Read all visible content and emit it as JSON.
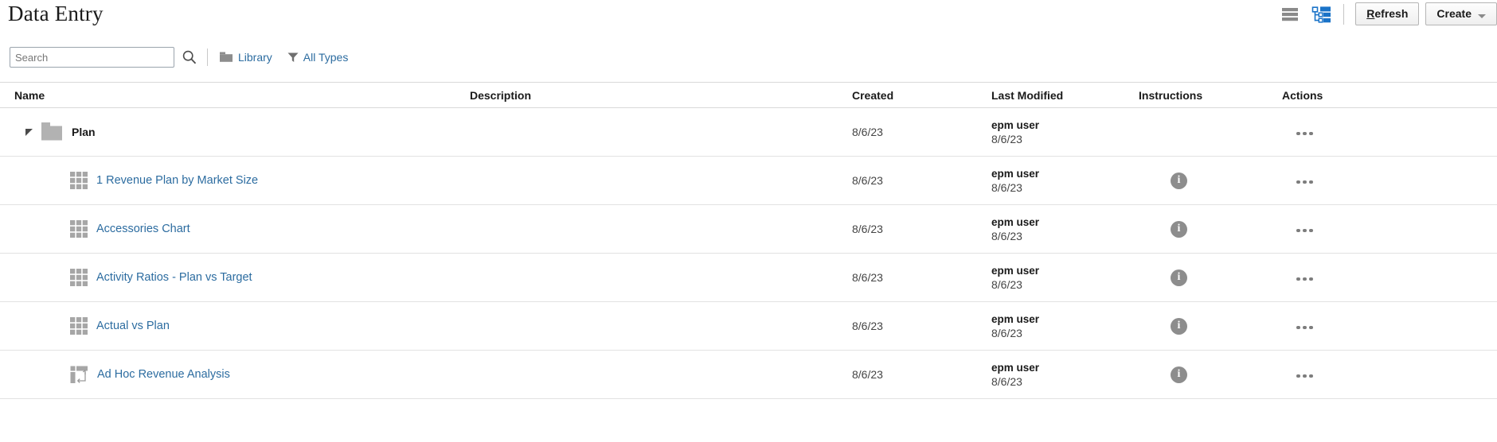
{
  "header": {
    "title": "Data Entry",
    "view_list_icon": "list-view-icon",
    "view_tree_icon": "tree-view-icon",
    "refresh_label_prefix": "R",
    "refresh_label_rest": "efresh",
    "create_label": "Create"
  },
  "toolbar": {
    "search_placeholder": "Search",
    "search_value": "",
    "search_icon": "search-icon",
    "library_label": "Library",
    "library_icon": "folder-icon",
    "all_types_label": "All Types",
    "all_types_icon": "filter-funnel-icon"
  },
  "table": {
    "columns": {
      "name": "Name",
      "description": "Description",
      "created": "Created",
      "last_modified": "Last Modified",
      "instructions": "Instructions",
      "actions": "Actions"
    },
    "rows": [
      {
        "type": "folder",
        "icon": "folder-icon",
        "name": "Plan",
        "description": "",
        "created": "8/6/23",
        "modified_user": "epm user",
        "modified_date": "8/6/23",
        "has_instructions": false
      },
      {
        "type": "form",
        "icon": "grid-icon",
        "name": "1 Revenue Plan by Market Size",
        "description": "",
        "created": "8/6/23",
        "modified_user": "epm user",
        "modified_date": "8/6/23",
        "has_instructions": true
      },
      {
        "type": "form",
        "icon": "grid-icon",
        "name": "Accessories Chart",
        "description": "",
        "created": "8/6/23",
        "modified_user": "epm user",
        "modified_date": "8/6/23",
        "has_instructions": true
      },
      {
        "type": "form",
        "icon": "grid-icon",
        "name": "Activity Ratios - Plan vs Target",
        "description": "",
        "created": "8/6/23",
        "modified_user": "epm user",
        "modified_date": "8/6/23",
        "has_instructions": true
      },
      {
        "type": "form",
        "icon": "grid-icon",
        "name": "Actual vs Plan",
        "description": "",
        "created": "8/6/23",
        "modified_user": "epm user",
        "modified_date": "8/6/23",
        "has_instructions": true
      },
      {
        "type": "adhoc",
        "icon": "adhoc-grid-icon",
        "name": "Ad Hoc Revenue Analysis",
        "description": "",
        "created": "8/6/23",
        "modified_user": "epm user",
        "modified_date": "8/6/23",
        "has_instructions": true
      }
    ]
  },
  "colors": {
    "link": "#2c6ca0",
    "icon_gray": "#a6a6a6",
    "tree_blue": "#1a73c8",
    "info_gray": "#8d8d8d"
  }
}
